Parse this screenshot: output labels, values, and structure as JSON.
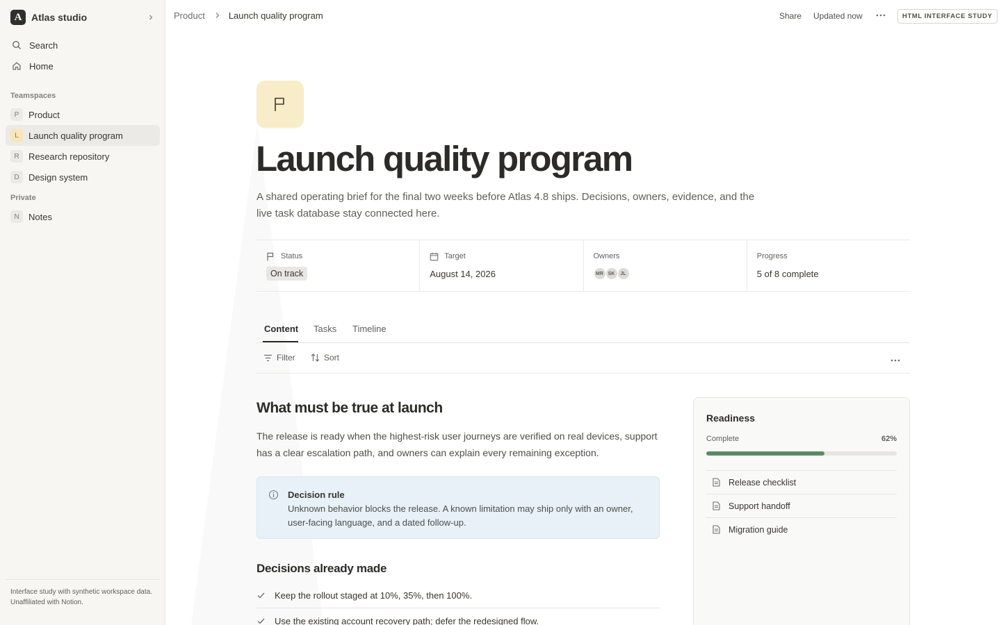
{
  "sidebar": {
    "workspace": {
      "logo": "A",
      "name": "Atlas studio"
    },
    "nav": [
      {
        "label": "Search",
        "icon": "search-icon"
      },
      {
        "label": "Home",
        "icon": "home-icon"
      }
    ],
    "teamspaces_label": "Teamspaces",
    "teamspaces": [
      {
        "badge": "P",
        "label": "Product"
      },
      {
        "badge": "L",
        "label": "Launch quality program",
        "active": true
      },
      {
        "badge": "R",
        "label": "Research repository"
      },
      {
        "badge": "D",
        "label": "Design system"
      }
    ],
    "private_label": "Private",
    "private": [
      {
        "badge": "N",
        "label": "Notes"
      }
    ],
    "footer": {
      "line1": "Interface study with synthetic workspace data.",
      "line2": "Unaffiliated with Notion."
    }
  },
  "topbar": {
    "breadcrumb": [
      "Product",
      "Launch quality program"
    ],
    "share": "Share",
    "updated": "Updated now",
    "study_badge": "HTML INTERFACE STUDY"
  },
  "page": {
    "icon": "flag-icon",
    "title": "Launch quality program",
    "description": "A shared operating brief for the final two weeks before Atlas 4.8 ships. Decisions, owners, evidence, and the live task database stay connected here.",
    "properties": {
      "status": {
        "label": "Status",
        "value": "On track"
      },
      "target": {
        "label": "Target",
        "value": "August 14, 2026"
      },
      "owners": {
        "label": "Owners",
        "initials": [
          "MR",
          "SK",
          "JL"
        ]
      },
      "progress": {
        "label": "Progress",
        "value": "5 of 8 complete"
      }
    },
    "tabs": [
      "Content",
      "Tasks",
      "Timeline"
    ],
    "active_tab": "Content",
    "toolbar": {
      "filter": "Filter",
      "sort": "Sort"
    }
  },
  "content": {
    "heading": "What must be true at launch",
    "paragraph": "The release is ready when the highest-risk user journeys are verified on real devices, support has a clear escalation path, and owners can explain every remaining exception.",
    "callout": {
      "title": "Decision rule",
      "text": "Unknown behavior blocks the release. A known limitation may ship only with an owner, user-facing language, and a dated follow-up."
    },
    "decisions_heading": "Decisions already made",
    "decisions": [
      "Keep the rollout staged at 10%, 35%, then 100%.",
      "Use the existing account recovery path; defer the redesigned flow."
    ]
  },
  "readiness": {
    "title": "Readiness",
    "complete_label": "Complete",
    "percent_label": "62%",
    "percent": 62,
    "links": [
      "Release checklist",
      "Support handoff",
      "Migration guide"
    ]
  },
  "colors": {
    "accent_progress": "#5b8a68",
    "callout_bg": "#e7f1f7",
    "icon_tile": "#f9ecc9",
    "sidebar_bg": "#f7f6f3"
  }
}
